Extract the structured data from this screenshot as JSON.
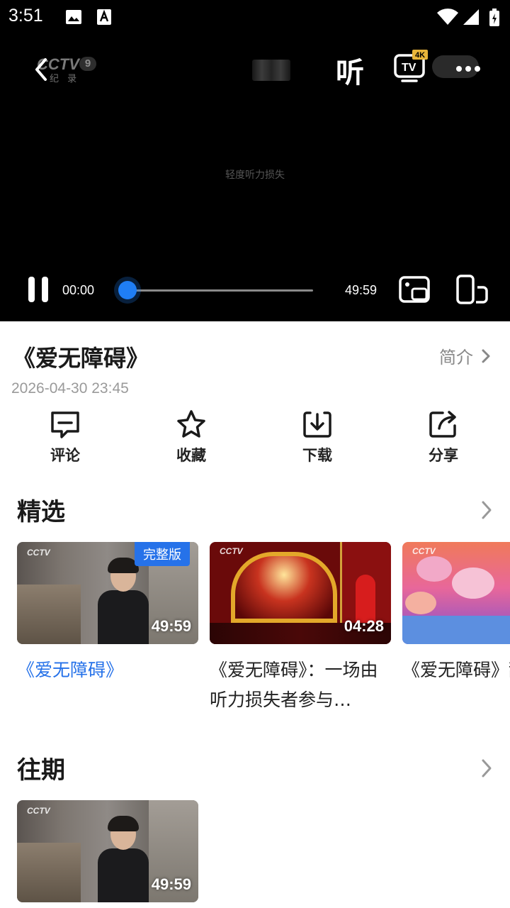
{
  "status_bar": {
    "time": "3:51"
  },
  "player": {
    "listen_label": "听",
    "tv_badge": "4K",
    "tv_label": "TV",
    "caption": "轻度听力损失",
    "current_time": "00:00",
    "total_time": "49:59",
    "progress": 0.03,
    "logo_text": "CCTV",
    "logo_channel": "9",
    "logo_sub": "纪 录"
  },
  "program": {
    "title": "《爱无障碍》",
    "intro_label": "简介",
    "date": "2026-04-30 23:45"
  },
  "actions": [
    {
      "label": "评论",
      "icon": "comment-icon"
    },
    {
      "label": "收藏",
      "icon": "star-icon"
    },
    {
      "label": "下载",
      "icon": "download-icon"
    },
    {
      "label": "分享",
      "icon": "share-icon"
    }
  ],
  "featured": {
    "title": "精选",
    "items": [
      {
        "duration": "49:59",
        "badge": "完整版",
        "title": "《爱无障碍》",
        "active": true
      },
      {
        "duration": "04:28",
        "title": "《爱无障碍》：一场由听力损失者参与…"
      },
      {
        "title": "《爱无障碍》甜——一位来"
      }
    ]
  },
  "past": {
    "title": "往期",
    "items": [
      {
        "duration": "49:59"
      }
    ]
  },
  "colors": {
    "accent": "#2672e9",
    "progress": "#1f7ef5"
  }
}
